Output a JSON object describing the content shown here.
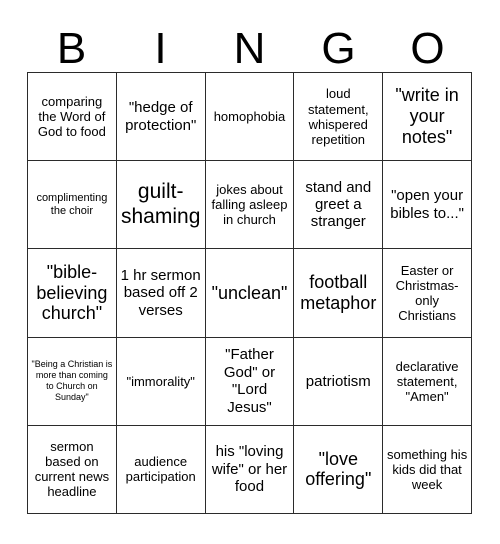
{
  "header": {
    "letters": [
      "B",
      "I",
      "N",
      "G",
      "O"
    ]
  },
  "grid": {
    "rows": [
      [
        {
          "text": "comparing the Word of God to food",
          "size": "fs-md"
        },
        {
          "text": "\"hedge of protection\"",
          "size": "fs-lg"
        },
        {
          "text": "homophobia",
          "size": "fs-md"
        },
        {
          "text": "loud statement, whispered repetition",
          "size": "fs-md"
        },
        {
          "text": "\"write in your notes\"",
          "size": "fs-xl"
        }
      ],
      [
        {
          "text": "complimenting the choir",
          "size": "fs-sm"
        },
        {
          "text": "guilt-shaming",
          "size": "fs-xxl"
        },
        {
          "text": "jokes about falling asleep in church",
          "size": "fs-md"
        },
        {
          "text": "stand and greet a stranger",
          "size": "fs-lg"
        },
        {
          "text": "\"open your bibles to...\"",
          "size": "fs-lg"
        }
      ],
      [
        {
          "text": "\"bible-believing church\"",
          "size": "fs-xl"
        },
        {
          "text": "1 hr sermon based off 2 verses",
          "size": "fs-lg"
        },
        {
          "text": "\"unclean\"",
          "size": "fs-xl"
        },
        {
          "text": "football metaphor",
          "size": "fs-xl"
        },
        {
          "text": "Easter or Christmas-only Christians",
          "size": "fs-md"
        }
      ],
      [
        {
          "text": "\"Being a Christian is more than coming to Church on Sunday\"",
          "size": "fs-xs"
        },
        {
          "text": "\"immorality\"",
          "size": "fs-md"
        },
        {
          "text": "\"Father God\" or \"Lord Jesus\"",
          "size": "fs-lg"
        },
        {
          "text": "patriotism",
          "size": "fs-lg"
        },
        {
          "text": "declarative statement, \"Amen\"",
          "size": "fs-md"
        }
      ],
      [
        {
          "text": "sermon based on current news headline",
          "size": "fs-md"
        },
        {
          "text": "audience participation",
          "size": "fs-md"
        },
        {
          "text": "his \"loving wife\" or her food",
          "size": "fs-lg"
        },
        {
          "text": "\"love offering\"",
          "size": "fs-xl"
        },
        {
          "text": "something his kids did that week",
          "size": "fs-md"
        }
      ]
    ]
  },
  "colors": {
    "background": "#ffffff",
    "border": "#2b2b2b",
    "text": "#000000"
  }
}
